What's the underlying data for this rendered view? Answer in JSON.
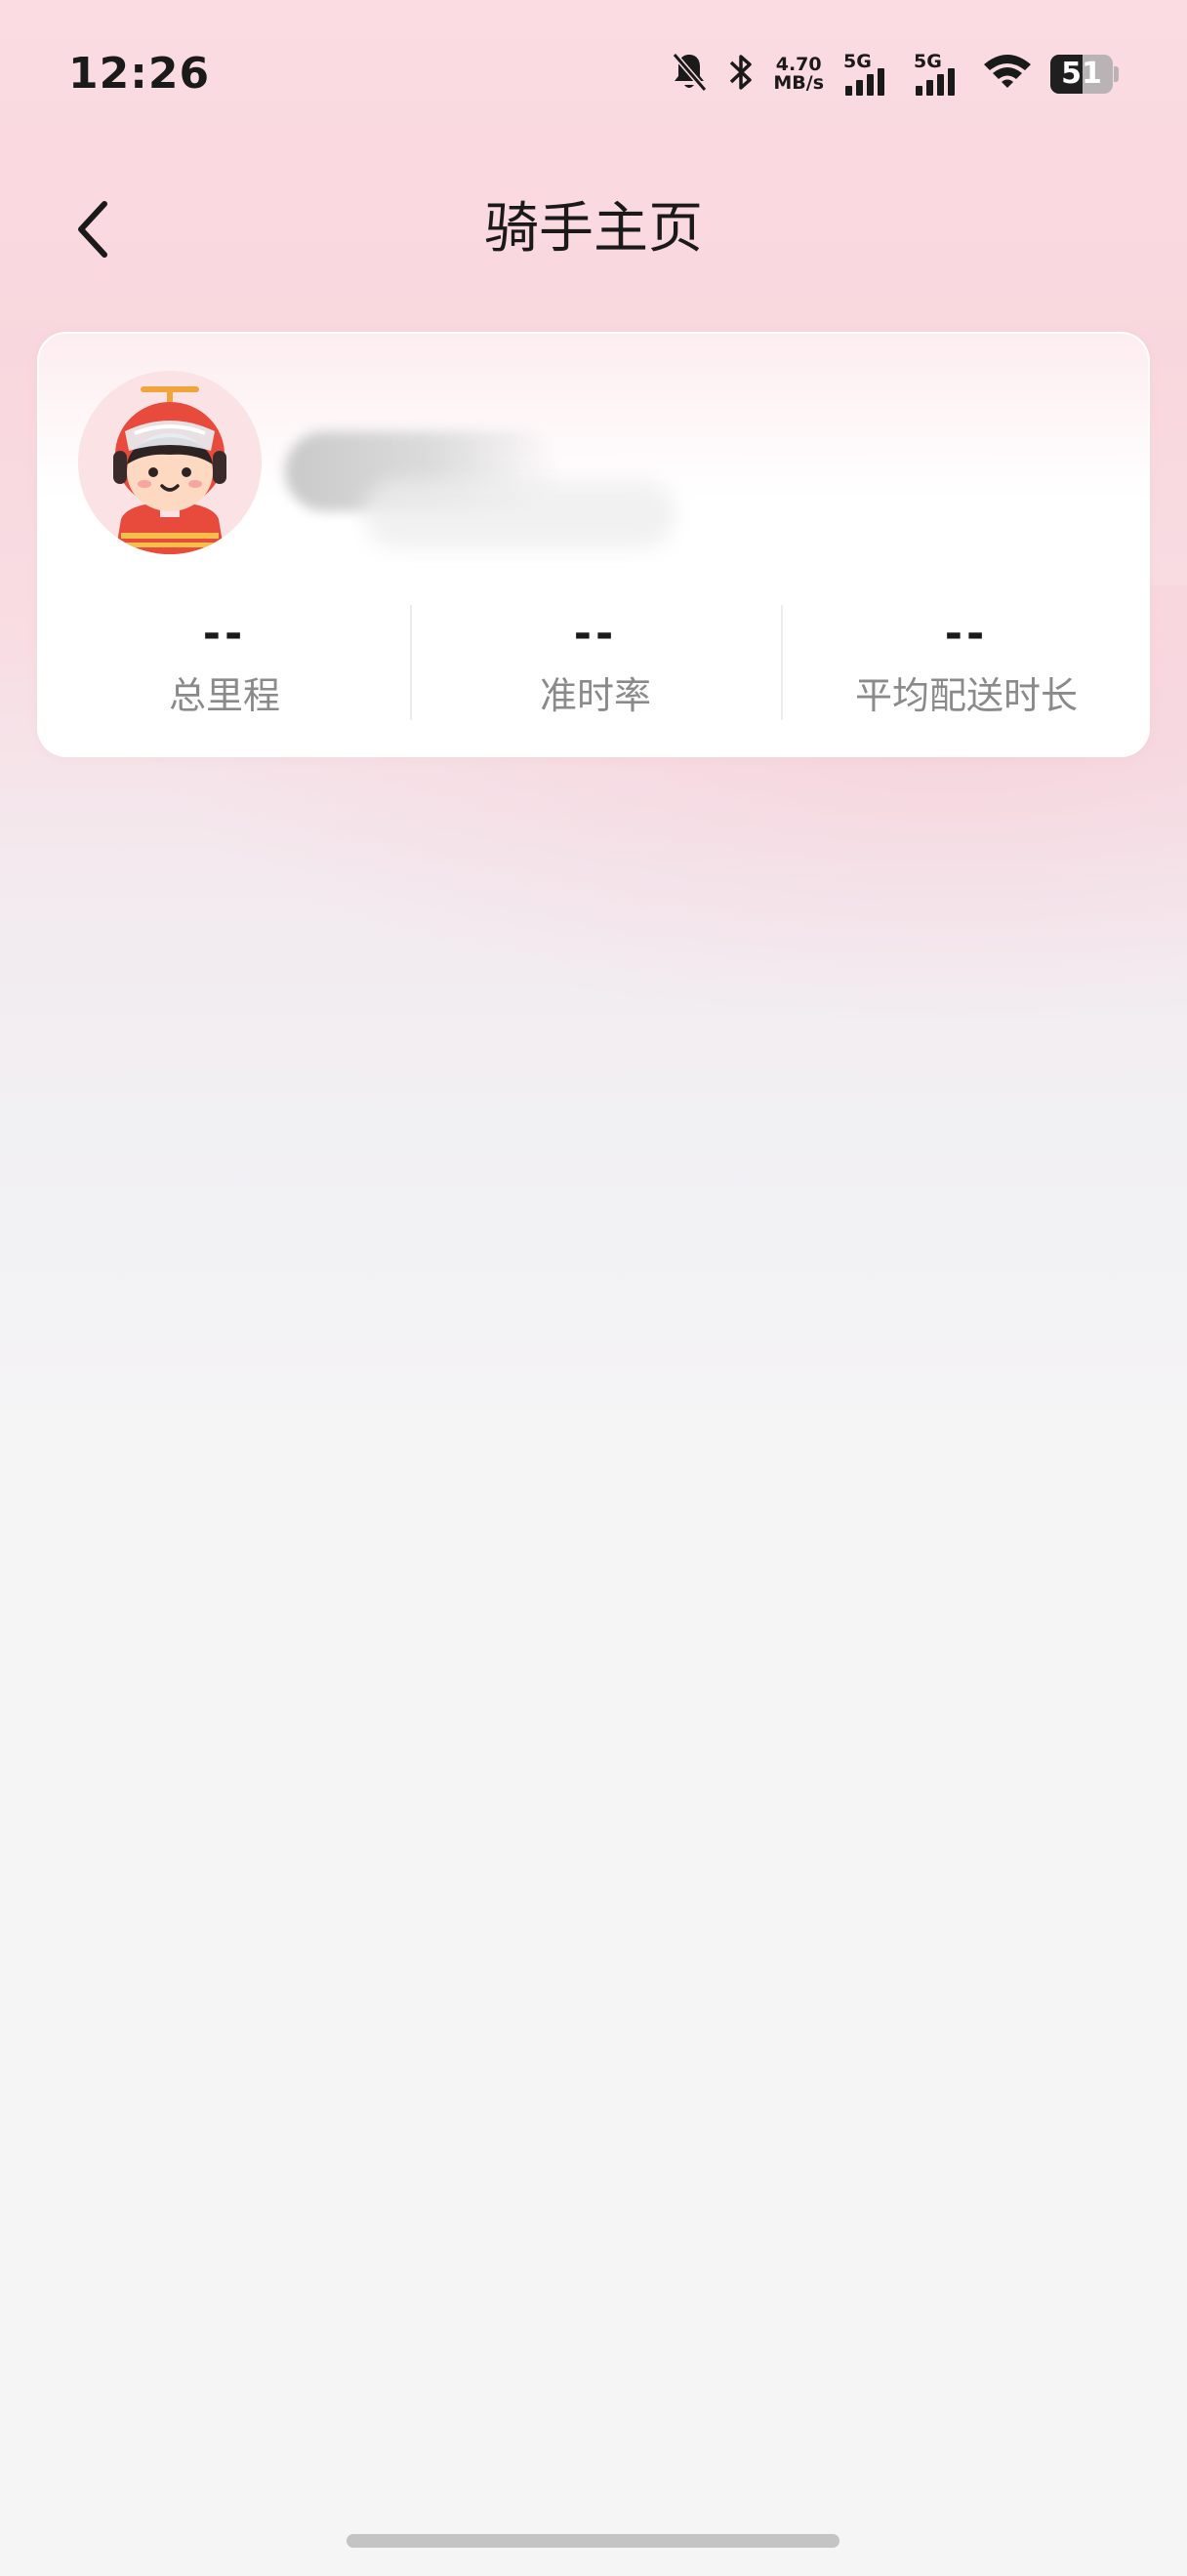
{
  "status_bar": {
    "time": "12:26",
    "net_speed_value": "4.70",
    "net_speed_unit": "MB/s",
    "sim1_label": "5G",
    "sim2_label": "5G",
    "battery_level": "51",
    "icons": [
      "bell-muted-icon",
      "bluetooth-icon",
      "signal-icon",
      "wifi-icon",
      "battery-icon"
    ]
  },
  "header": {
    "title": "骑手主页",
    "back_icon": "chevron-left-icon"
  },
  "rider_card": {
    "avatar_icon": "rider-avatar-icon",
    "stats": [
      {
        "value": "--",
        "label": "总里程"
      },
      {
        "value": "--",
        "label": "准时率"
      },
      {
        "value": "--",
        "label": "平均配送时长"
      }
    ]
  },
  "colors": {
    "background_top": "#fbdce2",
    "background_bottom": "#f5f5f5",
    "card": "#ffffff",
    "text_primary": "#1a1a1a",
    "text_secondary": "#8a8a8a",
    "avatar_bg": "#fbe2e4",
    "helmet_red": "#e84a3c"
  }
}
